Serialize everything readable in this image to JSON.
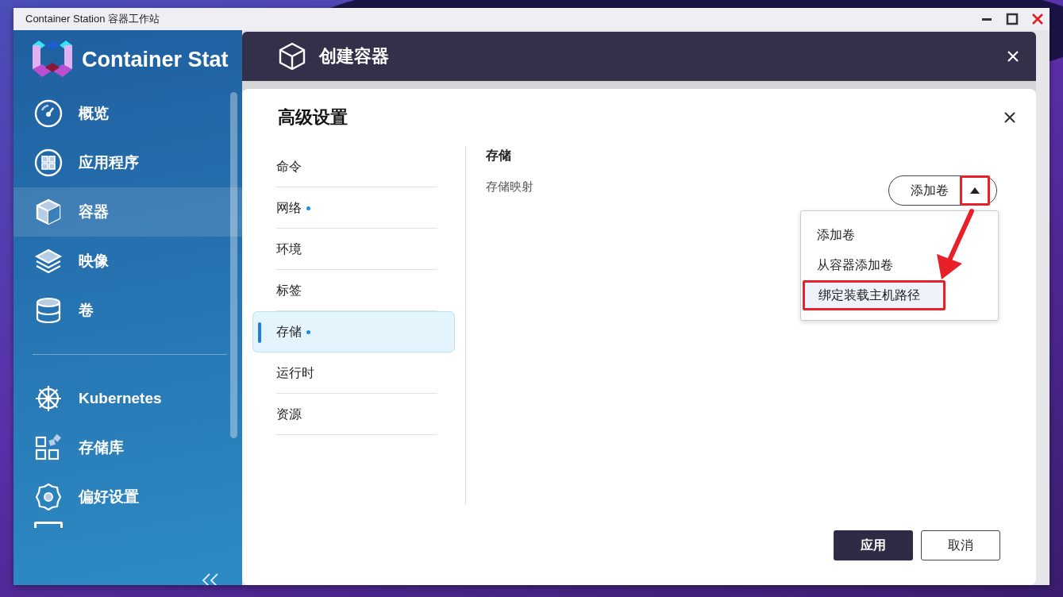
{
  "window": {
    "title": "Container Station 容器工作站"
  },
  "sidebar": {
    "app_name": "Container Stat",
    "items": [
      {
        "label": "概览",
        "kind": "gauge",
        "selected": false
      },
      {
        "label": "应用程序",
        "kind": "apps",
        "selected": false
      },
      {
        "label": "容器",
        "kind": "cube",
        "selected": true
      },
      {
        "label": "映像",
        "kind": "layers",
        "selected": false
      },
      {
        "label": "卷",
        "kind": "database",
        "selected": false
      },
      {
        "label": "Kubernetes",
        "kind": "helm",
        "selected": false
      },
      {
        "label": "存储库",
        "kind": "blocks",
        "selected": false
      },
      {
        "label": "偏好设置",
        "kind": "gear",
        "selected": false
      }
    ]
  },
  "modal": {
    "title": "创建容器"
  },
  "dialog": {
    "title": "高级设置",
    "nav": [
      {
        "label": "命令",
        "dot": false,
        "selected": false
      },
      {
        "label": "网络",
        "dot": true,
        "selected": false
      },
      {
        "label": "环境",
        "dot": false,
        "selected": false
      },
      {
        "label": "标签",
        "dot": false,
        "selected": false
      },
      {
        "label": "存储",
        "dot": true,
        "selected": true
      },
      {
        "label": "运行时",
        "dot": false,
        "selected": false
      },
      {
        "label": "资源",
        "dot": false,
        "selected": false
      }
    ],
    "section_title": "存储",
    "field_label": "存储映射",
    "add_button": "添加卷",
    "menu": [
      {
        "label": "添加卷",
        "selected": false
      },
      {
        "label": "从容器添加卷",
        "selected": false
      },
      {
        "label": "绑定装载主机路径",
        "selected": true
      }
    ],
    "buttons": [
      {
        "label": "应用",
        "kind": "primary"
      },
      {
        "label": "取消",
        "kind": "secondary"
      }
    ]
  }
}
